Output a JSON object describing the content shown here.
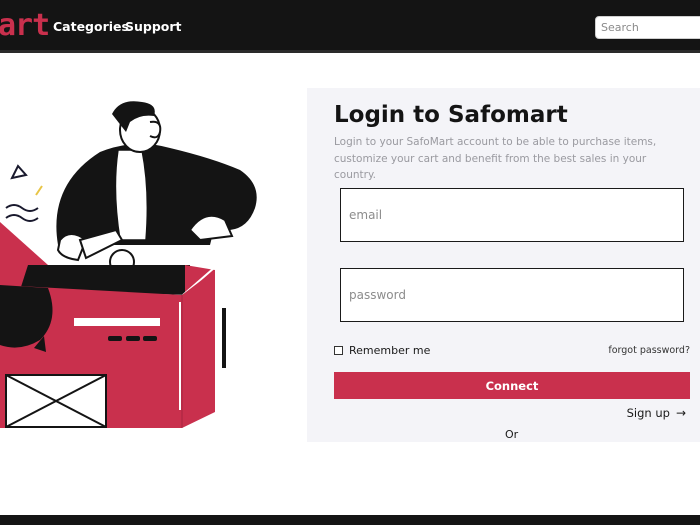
{
  "header": {
    "logo_text": "art",
    "nav": [
      "Categories",
      "Support"
    ],
    "search_placeholder": "Search"
  },
  "login": {
    "title": "Login to Safomart",
    "subtitle": "Login to your SafoMart account to be able to purchase items, customize your cart and benefit from the best sales in your country.",
    "email_placeholder": "email",
    "password_placeholder": "password",
    "remember_label": "Remember me",
    "forgot_label": "forgot password?",
    "connect_label": "Connect",
    "signup_label": "Sign up",
    "signup_arrow": "→",
    "or_label": "Or"
  },
  "colors": {
    "accent": "#c9304d",
    "header_bg": "#141414",
    "panel_bg": "#f4f4f8"
  }
}
